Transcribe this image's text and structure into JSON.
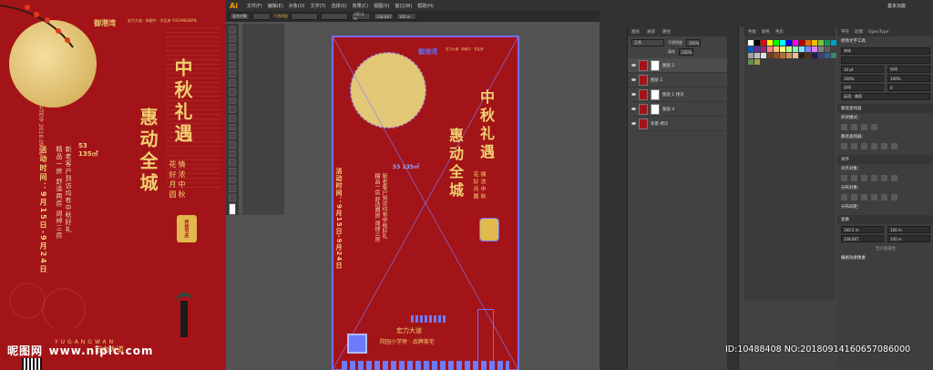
{
  "poster": {
    "logo": "御港湾",
    "logo_sub": "宏力大道 · 新都中 · 学区房 YUGANGWAN",
    "title_line1": "中秋礼遇",
    "title_line2": "惠动全城",
    "poem": "情浓中秋\n花好月圆",
    "stamp": "传统节庆",
    "date": "九月令 2018.09.15",
    "time": "活动时间：9月15日-9月24日",
    "area_num": "53",
    "area_unit": "135㎡",
    "info": "新老客户到访均有中秋好礼\n精品一房 舒适两房 阔绰三房",
    "bottom": "YUGANGWAN",
    "brand": "宏力大道"
  },
  "watermark": {
    "site_cn": "昵图网",
    "site_url": "www.nipic.com",
    "id_text": "ID:10488408 NO:20180914160657086000"
  },
  "illustrator": {
    "logo": "Ai",
    "menu": [
      "文件(F)",
      "编辑(E)",
      "对象(O)",
      "文字(T)",
      "选择(S)",
      "效果(C)",
      "视图(V)",
      "窗口(W)",
      "帮助(H)"
    ],
    "control": {
      "selection": "混合对象",
      "opacity_label": "不透明度",
      "x_value": "190.5 m",
      "y_value": "338.667",
      "w_value": "100 m"
    },
    "artboard": {
      "logo": "御港湾",
      "logo_sub": "宏力大道 · 新都中 · 学区房",
      "title_line1": "中秋礼遇",
      "title_line2": "惠动全城",
      "poem": "情浓中秋\n花好月圆",
      "time": "活动时间：9月15日-9月24日",
      "area": "53 135㎡",
      "info": "新老客户到访均有中秋好礼\n精品一房 舒适两房 阔绰三房",
      "brand": "宏力大道",
      "slogan": "院园小学旁 · 品牌美宅"
    }
  },
  "layers_panel": {
    "tabs": [
      "图层",
      "通道",
      "路径"
    ],
    "mode": "正常",
    "opacity_label": "不透明度",
    "opacity_value": "100%",
    "fill_label": "填充",
    "fill_value": "100%",
    "items": [
      {
        "name": "图层 2",
        "selected": true,
        "mask": true
      },
      {
        "name": "图层 1",
        "selected": false,
        "mask": false
      },
      {
        "name": "图层 1 拷贝",
        "selected": false,
        "mask": true
      },
      {
        "name": "图层 4",
        "selected": false,
        "mask": true
      },
      {
        "name": "背景 拷贝",
        "selected": false,
        "mask": false
      }
    ]
  },
  "swatches_panel": {
    "tabs": [
      "色板",
      "颜色",
      "色彩"
    ],
    "colors": [
      "#ffffff",
      "#000000",
      "#ff0000",
      "#ffff00",
      "#00ff00",
      "#00ffff",
      "#0000ff",
      "#ff00ff",
      "#c00000",
      "#e07000",
      "#f0c000",
      "#80c040",
      "#00a060",
      "#00a0c0",
      "#0060c0",
      "#6030a0",
      "#a02080",
      "#ff8080",
      "#ffc080",
      "#ffff80",
      "#c0ff80",
      "#80ffc0",
      "#80e0ff",
      "#8080ff",
      "#e080ff",
      "#808080",
      "#606060",
      "#404040",
      "#a0a0a0",
      "#c0c0c0",
      "#e0e0e0",
      "#704020",
      "#905030",
      "#b07040",
      "#d09060",
      "#f0c090",
      "#302010",
      "#503020",
      "#202040",
      "#404080",
      "#306090",
      "#408070",
      "#609050",
      "#a0a040"
    ]
  },
  "character_panel": {
    "tabs": [
      "字符",
      "段落",
      "OpenType"
    ],
    "font_label": "修饰文字工具",
    "font_name": "宋体",
    "size": "10 pt",
    "leading": "自动",
    "scale_v": "100%",
    "scale_h": "100%",
    "tracking": "0",
    "kerning": "自动",
    "language": "英语：美国",
    "sections": [
      "路径查找器",
      "形状模式：",
      "路径查找器：",
      "对齐",
      "对齐对象：",
      "分布对象：",
      "分布间距：",
      "变换"
    ],
    "transform_x": "190.5 m",
    "transform_y": "338.667",
    "transform_w": "100 m",
    "transform_h": "100 m",
    "no_appearance": "无外观属性",
    "appearance_label": "栅格效果像素",
    "workspace": "基本功能"
  }
}
